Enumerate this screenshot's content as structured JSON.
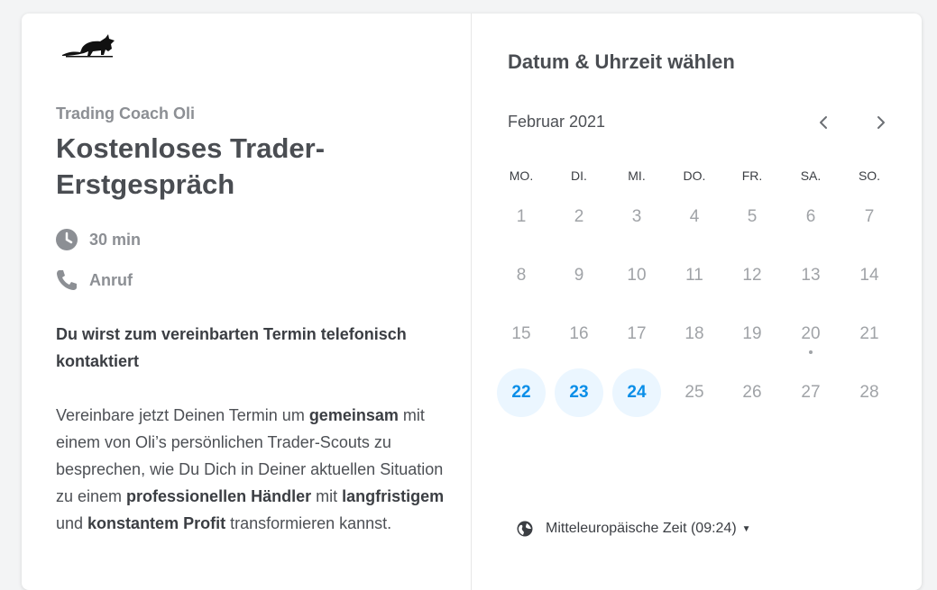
{
  "event": {
    "organizer": "Trading Coach Oli",
    "title": "Kostenloses Trader-Erstgespräch",
    "duration": "30 min",
    "location": "Anruf",
    "highlight": "Du wirst zum vereinbarten Termin telefonisch kontaktiert",
    "description": {
      "p1": "Vereinbare jetzt Deinen Termin um ",
      "b1": "gemeinsam",
      "p2": " mit einem von Oli’s persönlichen Trader-Scouts zu besprechen, wie Du Dich in Deiner aktuellen Situation zu einem ",
      "b2": "professionellen Händler",
      "p3": " mit ",
      "b3": "langfristigem",
      "p4": " und ",
      "b4": "konstantem Profit",
      "p5": " transformieren kannst."
    }
  },
  "calendar": {
    "heading": "Datum & Uhrzeit wählen",
    "month": "Februar 2021",
    "weekdays": [
      "MO.",
      "DI.",
      "MI.",
      "DO.",
      "FR.",
      "SA.",
      "SO."
    ],
    "weeks": [
      [
        "1",
        "2",
        "3",
        "4",
        "5",
        "6",
        "7"
      ],
      [
        "8",
        "9",
        "10",
        "11",
        "12",
        "13",
        "14"
      ],
      [
        "15",
        "16",
        "17",
        "18",
        "19",
        "20",
        "21"
      ],
      [
        "22",
        "23",
        "24",
        "25",
        "26",
        "27",
        "28"
      ]
    ],
    "available_days": [
      "22",
      "23",
      "24"
    ],
    "today": "20",
    "timezone": "Mitteleuropäische Zeit (09:24)"
  },
  "icons": {
    "logo": "bull-logo-icon",
    "duration": "clock-icon",
    "location": "phone-icon",
    "prev": "chevron-left-icon",
    "next": "chevron-right-icon",
    "timezone": "globe-icon",
    "timezone_menu": "caret-down-icon"
  },
  "colors": {
    "accent": "#0a8ee8",
    "available_bg": "#ebf6ff",
    "muted_text": "#8c8f94",
    "heading_text": "#4a4d52"
  }
}
